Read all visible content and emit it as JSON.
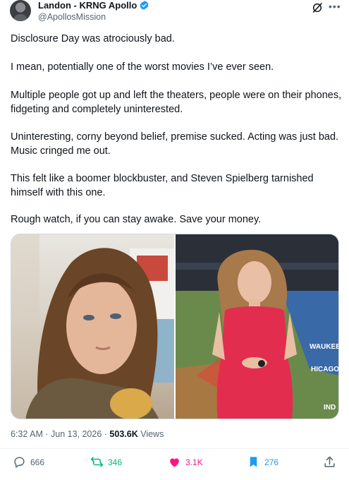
{
  "author": {
    "display_name": "Landon - KRNG Apollo",
    "handle": "@ApollosMission",
    "verified": true
  },
  "tweet": {
    "paragraphs": [
      "Disclosure Day was atrociously bad.",
      "I mean, potentially one of the worst movies I’ve ever seen.",
      "Multiple people got up and left the theaters, people were on their phones, fidgeting and completely uninterested.",
      "Uninteresting, corny beyond belief, premise sucked. Acting was just bad. Music cringed me out.",
      "This felt like a boomer blockbuster, and Steven Spielberg tarnished himself with this one.",
      "Rough watch, if you can stay awake. Save your money."
    ]
  },
  "media": {
    "right_overlay": [
      "WAUKEE",
      "HICAGO",
      "IND"
    ]
  },
  "meta": {
    "time": "6:32 AM",
    "date": "Jun 13, 2026",
    "views_count": "503.6K",
    "views_label": "Views"
  },
  "actions": {
    "replies": "666",
    "reposts": "346",
    "likes": "3.1K",
    "bookmarks": "276"
  },
  "colors": {
    "text": "#0f1419",
    "secondary": "#536471",
    "verified": "#1d9bf0",
    "repost": "#00ba7c",
    "like": "#f91880",
    "bookmark": "#1d9bf0"
  },
  "icons": [
    "verified-badge-icon",
    "grok-icon",
    "more-icon",
    "reply-icon",
    "repost-icon",
    "like-icon",
    "bookmark-icon",
    "share-icon"
  ]
}
